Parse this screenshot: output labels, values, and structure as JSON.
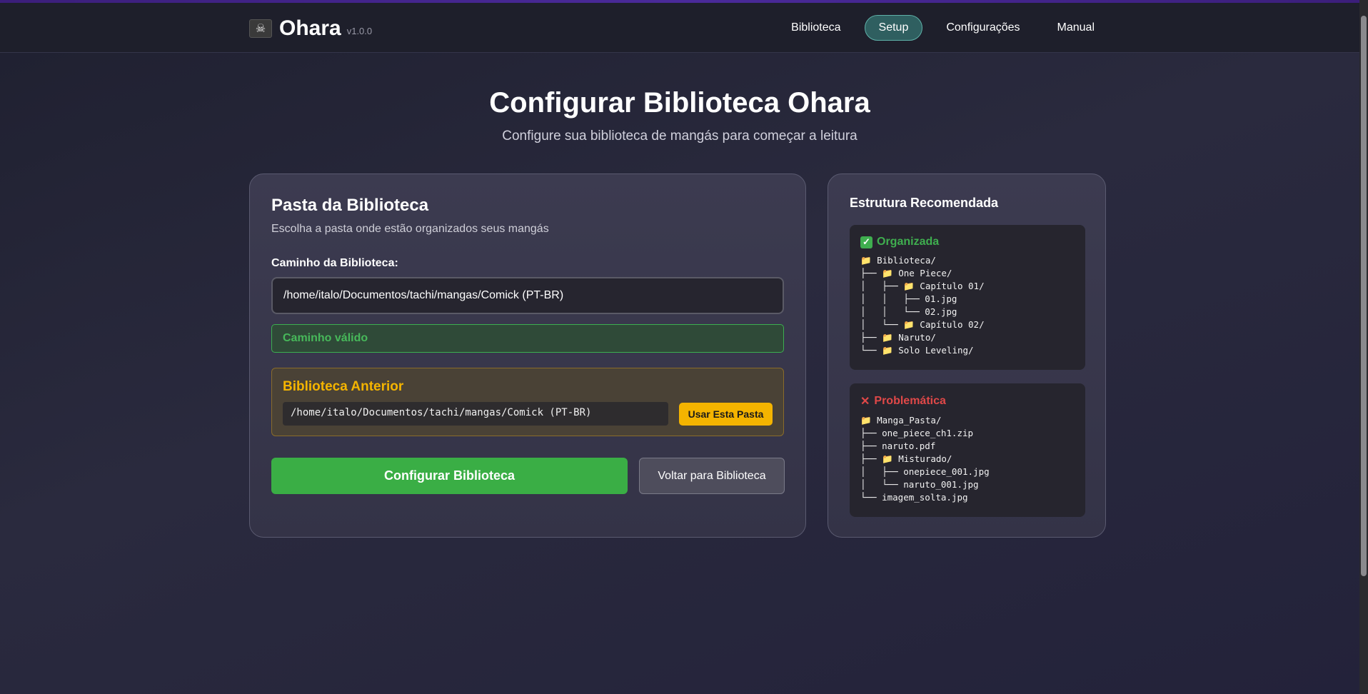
{
  "app": {
    "name": "Ohara",
    "version": "v1.0.0",
    "logo_icon": "pirate-flag-icon",
    "logo_glyph": "☠"
  },
  "nav": {
    "items": [
      {
        "label": "Biblioteca",
        "active": false
      },
      {
        "label": "Setup",
        "active": true
      },
      {
        "label": "Configurações",
        "active": false
      },
      {
        "label": "Manual",
        "active": false
      }
    ]
  },
  "hero": {
    "title": "Configurar Biblioteca Ohara",
    "subtitle": "Configure sua biblioteca de mangás para começar a leitura"
  },
  "library_card": {
    "title": "Pasta da Biblioteca",
    "description": "Escolha a pasta onde estão organizados seus mangás",
    "path_label": "Caminho da Biblioteca:",
    "path_value": "/home/italo/Documentos/tachi/mangas/Comick (PT-BR)",
    "status": "Caminho válido",
    "previous": {
      "title": "Biblioteca Anterior",
      "path": "/home/italo/Documentos/tachi/mangas/Comick (PT-BR)",
      "use_button": "Usar Esta Pasta"
    },
    "configure_button": "Configurar Biblioteca",
    "back_button": "Voltar para Biblioteca"
  },
  "structure_card": {
    "title": "Estrutura Recomendada",
    "good": {
      "heading": "Organizada",
      "icon": "check-icon",
      "lines": [
        "📁 Biblioteca/",
        "├── 📁 One Piece/",
        "│   ├── 📁 Capítulo 01/",
        "│   │   ├── 01.jpg",
        "│   │   └── 02.jpg",
        "│   └── 📁 Capítulo 02/",
        "├── 📁 Naruto/",
        "└── 📁 Solo Leveling/"
      ]
    },
    "bad": {
      "heading": "Problemática",
      "icon": "cross-icon",
      "lines": [
        "📁 Manga_Pasta/",
        "├── one_piece_ch1.zip",
        "├── naruto.pdf",
        "├── 📁 Misturado/",
        "│   ├── onepiece_001.jpg",
        "│   └── naruto_001.jpg",
        "└── imagem_solta.jpg"
      ]
    }
  },
  "colors": {
    "accent_green": "#3aae45",
    "accent_yellow": "#f4b400",
    "error_red": "#e04848",
    "active_nav": "#2f5f60"
  }
}
